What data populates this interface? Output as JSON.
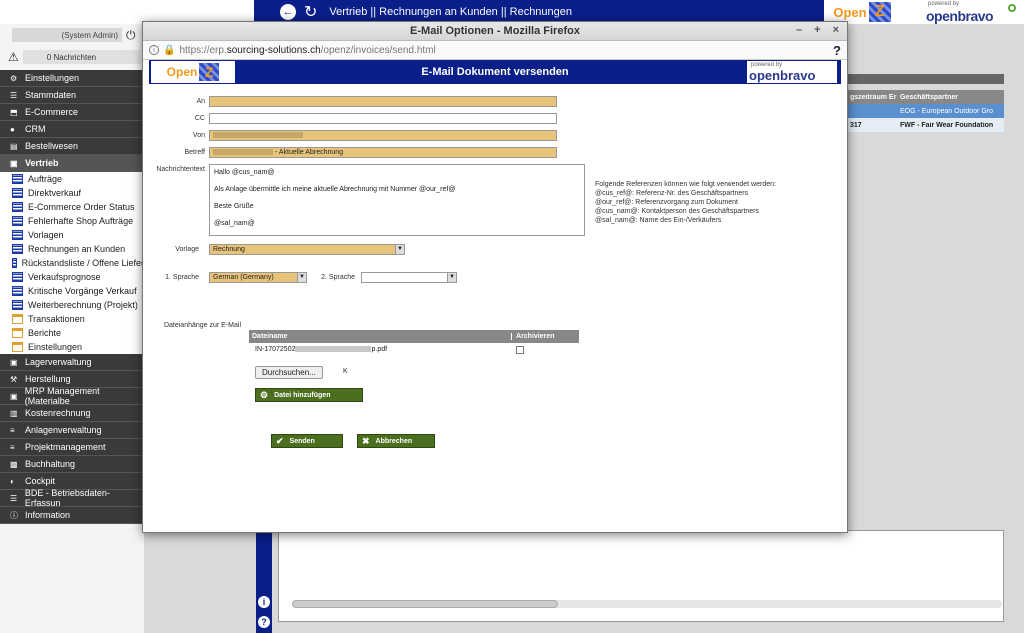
{
  "topbar": {
    "breadcrumb": "Vertrieb || Rechnungen an Kunden  ||  Rechnungen",
    "logo_openz_text": "Open",
    "logo_openz_z": "Z",
    "logo_ob_powered": "powered by",
    "logo_ob_text": "openbravo"
  },
  "sidebar": {
    "user_label": "(System Admin)",
    "messages_label": "0 Nachrichten",
    "sections_top": [
      {
        "label": "Einstellungen",
        "icon": "gear-icon"
      },
      {
        "label": "Stammdaten",
        "icon": "list-icon"
      },
      {
        "label": "E-Commerce",
        "icon": "cart-icon"
      },
      {
        "label": "CRM",
        "icon": "chat-icon"
      },
      {
        "label": "Bestellwesen",
        "icon": "document-icon"
      },
      {
        "label": "Vertrieb",
        "icon": "truck-icon"
      }
    ],
    "vertrieb_items": [
      {
        "label": "Aufträge",
        "icon": "grid"
      },
      {
        "label": "Direktverkauf",
        "icon": "grid"
      },
      {
        "label": "E-Commerce Order Status",
        "icon": "grid"
      },
      {
        "label": "Fehlerhafte Shop Aufträge",
        "icon": "grid"
      },
      {
        "label": "Vorlagen",
        "icon": "grid"
      },
      {
        "label": "Rechnungen an Kunden",
        "icon": "grid"
      },
      {
        "label": "Rückstandsliste / Offene Liefer",
        "icon": "grid"
      },
      {
        "label": "Verkaufsprognose",
        "icon": "grid"
      },
      {
        "label": "Kritische Vorgänge Verkauf",
        "icon": "grid"
      },
      {
        "label": "Weiterberechnung (Projekt)",
        "icon": "grid"
      },
      {
        "label": "Transaktionen",
        "icon": "folder"
      },
      {
        "label": "Berichte",
        "icon": "folder"
      },
      {
        "label": "Einstellungen",
        "icon": "folder"
      }
    ],
    "sections_bottom": [
      {
        "label": "Lagerverwaltung",
        "icon": "truck-icon"
      },
      {
        "label": "Herstellung",
        "icon": "hammer-icon"
      },
      {
        "label": "MRP Management (Materialbe",
        "icon": "truck-icon"
      },
      {
        "label": "Kostenrechnung",
        "icon": "chart-icon"
      },
      {
        "label": "Anlagenverwaltung",
        "icon": "bars-icon"
      },
      {
        "label": "Projektmanagement",
        "icon": "bars-icon"
      },
      {
        "label": "Buchhaltung",
        "icon": "money-icon"
      },
      {
        "label": "Cockpit",
        "icon": "cockpit-icon"
      },
      {
        "label": "BDE - Betriebsdaten-Erfassun",
        "icon": "list-icon"
      },
      {
        "label": "Information",
        "icon": "info-icon"
      }
    ]
  },
  "background_table": {
    "headers": [
      "gszeitraum Er",
      "Geschäftspartner"
    ],
    "rows": [
      [
        "",
        "EOG - European Outdoor Gro"
      ],
      [
        "317",
        "FWF - Fair Wear Foundation"
      ]
    ]
  },
  "window": {
    "title": "E-Mail Optionen - Mozilla Firefox",
    "url_prefix": "https://erp.",
    "url_host": "sourcing-solutions.ch",
    "url_path": "/openz/invoices/send.html",
    "help_glyph": "?"
  },
  "dialog": {
    "header_title": "E-Mail Dokument versenden",
    "labels": {
      "an": "An",
      "cc": "CC",
      "von": "Von",
      "betreff": "Betreff",
      "nachrichtentext": "Nachrichtentext",
      "vorlage": "Vorlage",
      "sprache1": "1. Sprache",
      "sprache2": "2. Sprache",
      "anhaenge": "Dateianhänge zur E-Mail"
    },
    "betreff_suffix": " - Aktuelle Abrechnung",
    "message_lines": [
      "Hallo @cus_nam@",
      "Als Anlage übermittle ich meine aktuelle Abrechnung mit Nummer @our_ref@",
      "Beste Grüße",
      "@sal_nam@"
    ],
    "references": [
      "Folgende Referenzen können wie folgt verwendet werden:",
      "@cus_ref@: Referenz-Nr. des Geschäftspartners",
      "@our_ref@: Referenzvorgang zum Dokument",
      "@cus_nam@: Kontaktperson des Geschäftspartners",
      "@sal_nam@: Name des Ein-/Verkäufers"
    ],
    "vorlage_value": "Rechnung",
    "sprache1_value": "German (Germany)",
    "sprache2_value": "",
    "attachments": {
      "col_file": "Dateiname",
      "col_archive": "Archivieren",
      "file_prefix": "IN-17072502",
      "file_suffix": "p.pdf"
    },
    "browse_label": "Durchsuchen...",
    "browse_suffix": "K",
    "add_file_label": "Datei hinzufügen",
    "send_label": "Senden",
    "cancel_label": "Abbrechen"
  },
  "colors": {
    "brand_blue": "#0a1f8a",
    "required_field": "#e8c47a",
    "action_green": "#4b6f1e",
    "menu_dark": "#3a3a3a"
  }
}
